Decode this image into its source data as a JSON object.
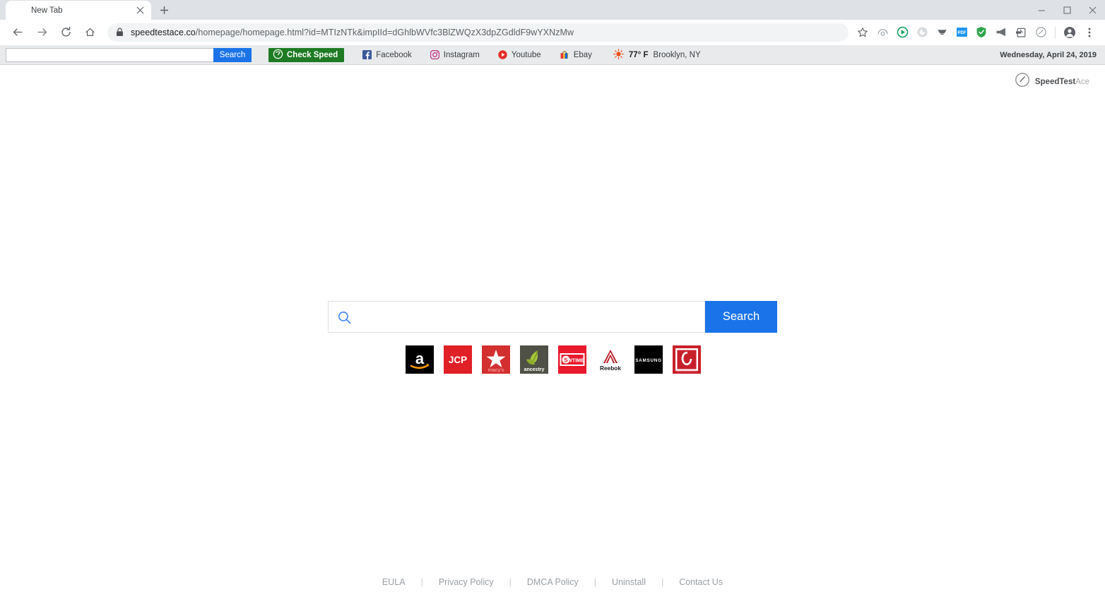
{
  "window": {
    "minimize_label": "Minimize",
    "maximize_label": "Maximize",
    "close_label": "Close"
  },
  "tabs": [
    {
      "title": "New Tab",
      "close_label": "Close tab"
    }
  ],
  "new_tab_button_label": "New tab",
  "omnibox": {
    "back_label": "Back",
    "forward_label": "Forward",
    "reload_label": "Reload",
    "home_label": "Home",
    "security_label": "Secure",
    "url_host": "speedtestace.co",
    "url_path": "/homepage/homepage.html?id=MTIzNTk&impIId=dGhlbWVfc3BlZWQzX3dpZGdldF9wYXNzMw",
    "bookmark_label": "Bookmark this page",
    "profile_label": "Profile",
    "menu_label": "Customize and control Google Chrome",
    "extensions": [
      {
        "name": "history-extension-icon"
      },
      {
        "name": "play-extension-icon"
      },
      {
        "name": "cast-extension-icon"
      },
      {
        "name": "screen-extension-icon"
      },
      {
        "name": "pdf-extension-icon",
        "label": "PDF"
      },
      {
        "name": "shield-extension-icon"
      },
      {
        "name": "megaphone-extension-icon"
      },
      {
        "name": "clipper-extension-icon"
      },
      {
        "name": "speedometer-extension-icon"
      }
    ]
  },
  "extbar": {
    "search_placeholder": "",
    "search_value": "",
    "search_button_label": "Search",
    "check_speed_label": "Check Speed",
    "links": [
      {
        "label": "Facebook",
        "icon": "facebook-icon"
      },
      {
        "label": "Instagram",
        "icon": "instagram-icon"
      },
      {
        "label": "Youtube",
        "icon": "youtube-icon"
      },
      {
        "label": "Ebay",
        "icon": "ebay-icon"
      }
    ],
    "weather": {
      "icon": "sun-icon",
      "temperature": "77° F",
      "location": "Brooklyn, NY"
    },
    "date": "Wednesday, April 24, 2019"
  },
  "page": {
    "logo": {
      "icon": "speedometer-logo-icon",
      "bold_text": "SpeedTest",
      "light_text": "Ace"
    },
    "search": {
      "placeholder": "",
      "value": "",
      "button_label": "Search",
      "icon": "search-icon"
    },
    "tiles": [
      {
        "name": "amazon",
        "label": "a",
        "bg": "#000000",
        "fg": "#ffffff"
      },
      {
        "name": "jcpenney",
        "label": "JCP",
        "bg": "#e01f26",
        "fg": "#ffffff"
      },
      {
        "name": "macys",
        "label": "macy's",
        "bg": "#d32f2f",
        "fg": "#ffffff"
      },
      {
        "name": "ancestry",
        "label": "ancestry",
        "bg": "#4f5146",
        "fg": "#ffffff"
      },
      {
        "name": "showtime",
        "label": "SHOWTIME",
        "bg": "#e8192c",
        "fg": "#ffffff"
      },
      {
        "name": "reebok",
        "label": "Reebok",
        "bg": "#ffffff",
        "fg": "#b5121b"
      },
      {
        "name": "samsung",
        "label": "SAMSUNG",
        "bg": "#000000",
        "fg": "#ffffff"
      },
      {
        "name": "overstock",
        "label": "overstock.com",
        "bg": "#c8202a",
        "fg": "#ffffff"
      }
    ],
    "footer": [
      {
        "label": "EULA"
      },
      {
        "label": "Privacy Policy"
      },
      {
        "label": "DMCA Policy"
      },
      {
        "label": "Uninstall"
      },
      {
        "label": "Contact Us"
      }
    ],
    "footer_separator": "|"
  },
  "colors": {
    "chrome_tabstrip": "#dee1e6",
    "accent_blue": "#1a73e8",
    "check_speed_green": "#1e7b23",
    "extbar_bg": "#e8eaec"
  }
}
